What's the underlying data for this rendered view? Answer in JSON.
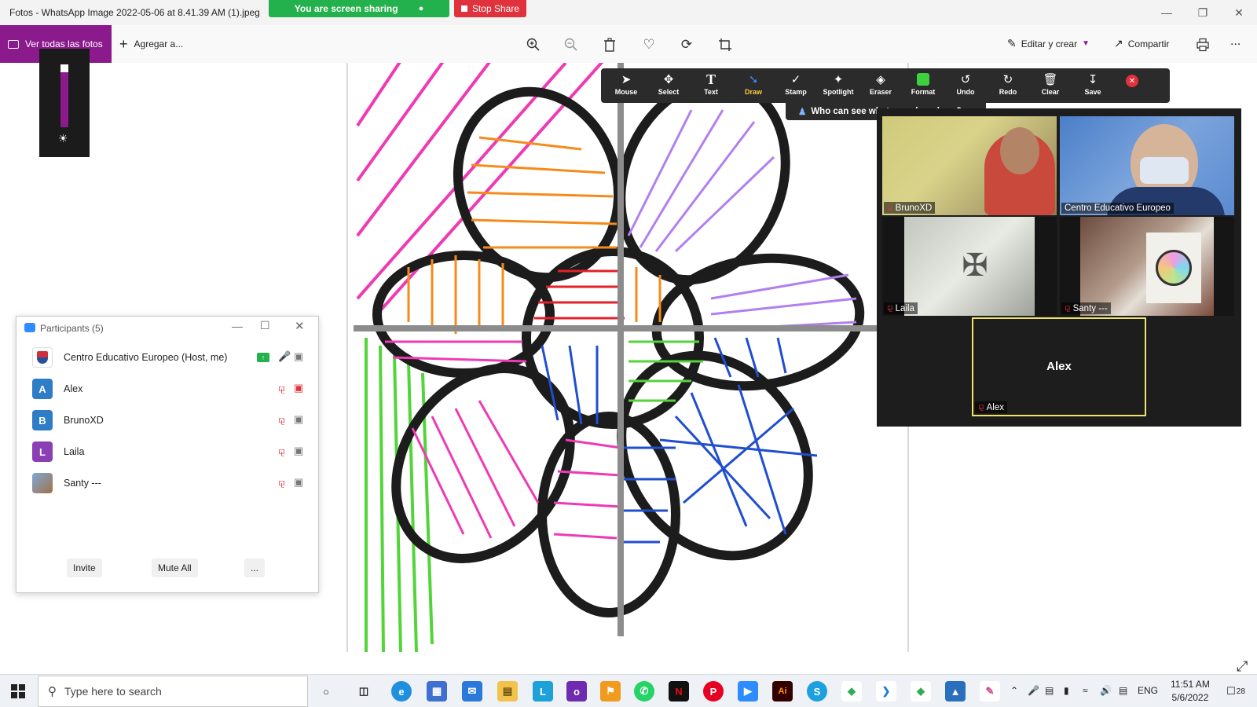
{
  "window": {
    "title": "Fotos - WhatsApp Image 2022-05-06 at 8.41.39 AM (1).jpeg"
  },
  "share": {
    "banner": "You are screen sharing",
    "stop": "Stop Share"
  },
  "toolbar": {
    "view_all": "Ver todas las fotos",
    "add_to": "Agregar a...",
    "edit_create": "Editar y crear",
    "share": "Compartir",
    "more": "..."
  },
  "annotation": {
    "tools": [
      "Mouse",
      "Select",
      "Text",
      "Draw",
      "Stamp",
      "Spotlight",
      "Eraser",
      "Format",
      "Undo",
      "Redo",
      "Clear",
      "Save"
    ],
    "active": "Draw",
    "who_can_see": "Who can see what you share here?"
  },
  "gallery": {
    "tiles": [
      {
        "name": "BrunoXD",
        "muted": true
      },
      {
        "name": "Centro Educativo Europeo",
        "muted": false
      },
      {
        "name": "Laila",
        "muted": true
      },
      {
        "name": "Santy ---",
        "muted": true
      },
      {
        "name": "Alex",
        "muted": true,
        "placeholder": "Alex"
      }
    ]
  },
  "participants": {
    "title": "Participants (5)",
    "rows": [
      {
        "name": "Centro Educativo Europeo (Host, me)",
        "avatar": "",
        "color": "#ffffff"
      },
      {
        "name": "Alex",
        "avatar": "A",
        "color": "#2e7dc6"
      },
      {
        "name": "BrunoXD",
        "avatar": "B",
        "color": "#2e7dc6"
      },
      {
        "name": "Laila",
        "avatar": "L",
        "color": "#8b3fb5"
      },
      {
        "name": "Santy ---",
        "avatar": "",
        "color": "#a0714a"
      }
    ],
    "invite": "Invite",
    "mute_all": "Mute All",
    "more": "..."
  },
  "taskbar": {
    "search_placeholder": "Type here to search",
    "lang": "ENG",
    "time": "11:51 AM",
    "date": "5/6/2022",
    "notifications": "28"
  }
}
